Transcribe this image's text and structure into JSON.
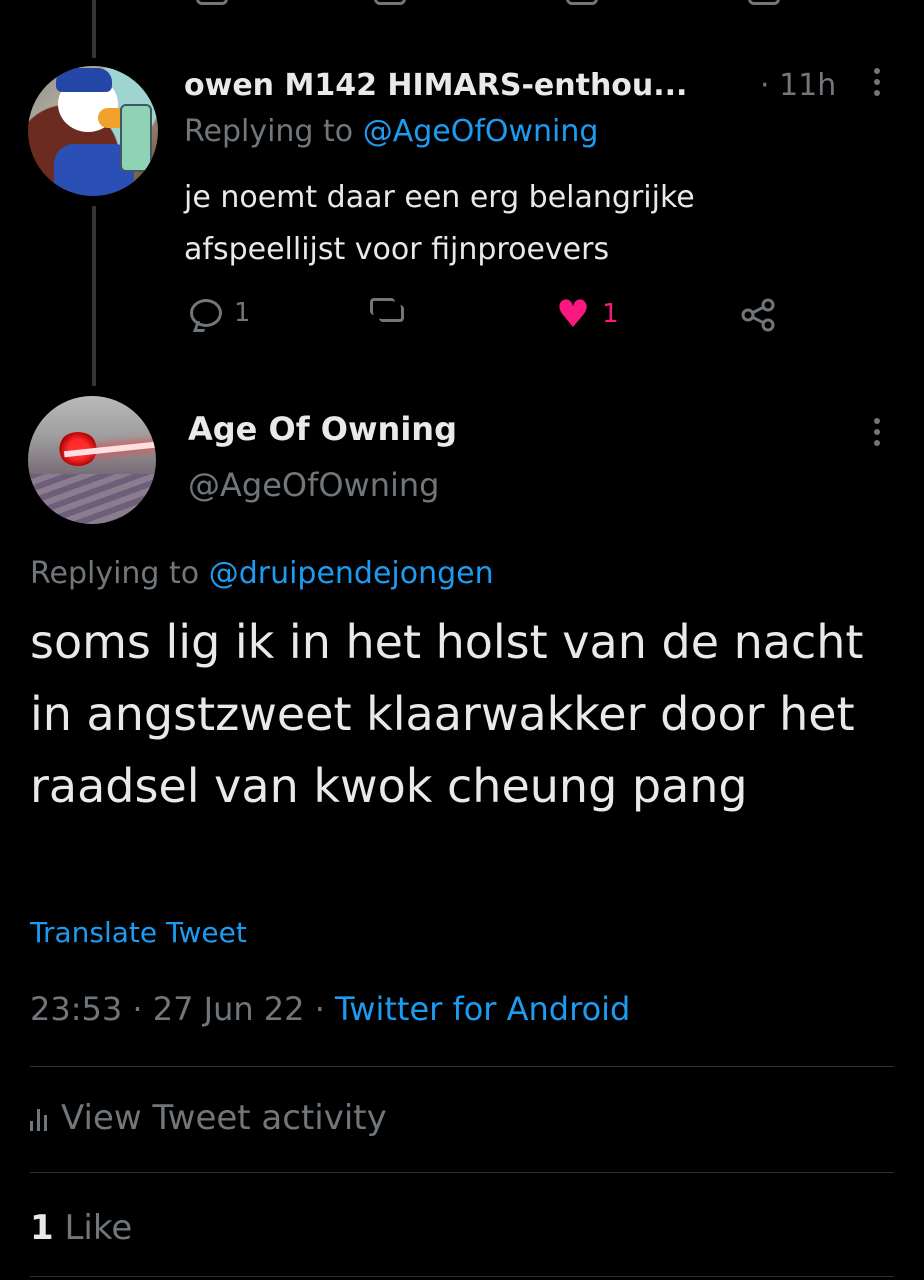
{
  "reply_tweet": {
    "author_name": "owen M142 HIMARS-enthou...",
    "time": "· 11h",
    "replying_label": "Replying to",
    "replying_handle": "@AgeOfOwning",
    "text": "je noemt daar een erg belangrijke afspeellijst voor fijnproevers",
    "actions": {
      "replies": "1",
      "likes": "1"
    },
    "colors": {
      "like": "#f91880"
    }
  },
  "main_tweet": {
    "author_name": "Age Of Owning",
    "author_handle": "@AgeOfOwning",
    "replying_label": "Replying to",
    "replying_handle": "@druipendejongen",
    "text": "soms lig ik in het holst van de nacht in angstzweet klaarwakker door het raadsel van kwok cheung pang",
    "translate_label": "Translate Tweet",
    "time": "23:53",
    "date": "27 Jun 22",
    "source": "Twitter for Android",
    "activity_label": "View Tweet activity",
    "likes_count": "1",
    "likes_label": "Like"
  },
  "icons": {
    "reply": "reply-bubble-icon",
    "retweet": "retweet-icon",
    "like": "heart-icon",
    "share": "share-icon",
    "more": "more-vertical-icon",
    "activity": "bar-chart-icon"
  },
  "colors": {
    "background": "#000000",
    "primary_text": "#e7e9ea",
    "secondary_text": "#71767b",
    "link": "#1d9bf0"
  }
}
